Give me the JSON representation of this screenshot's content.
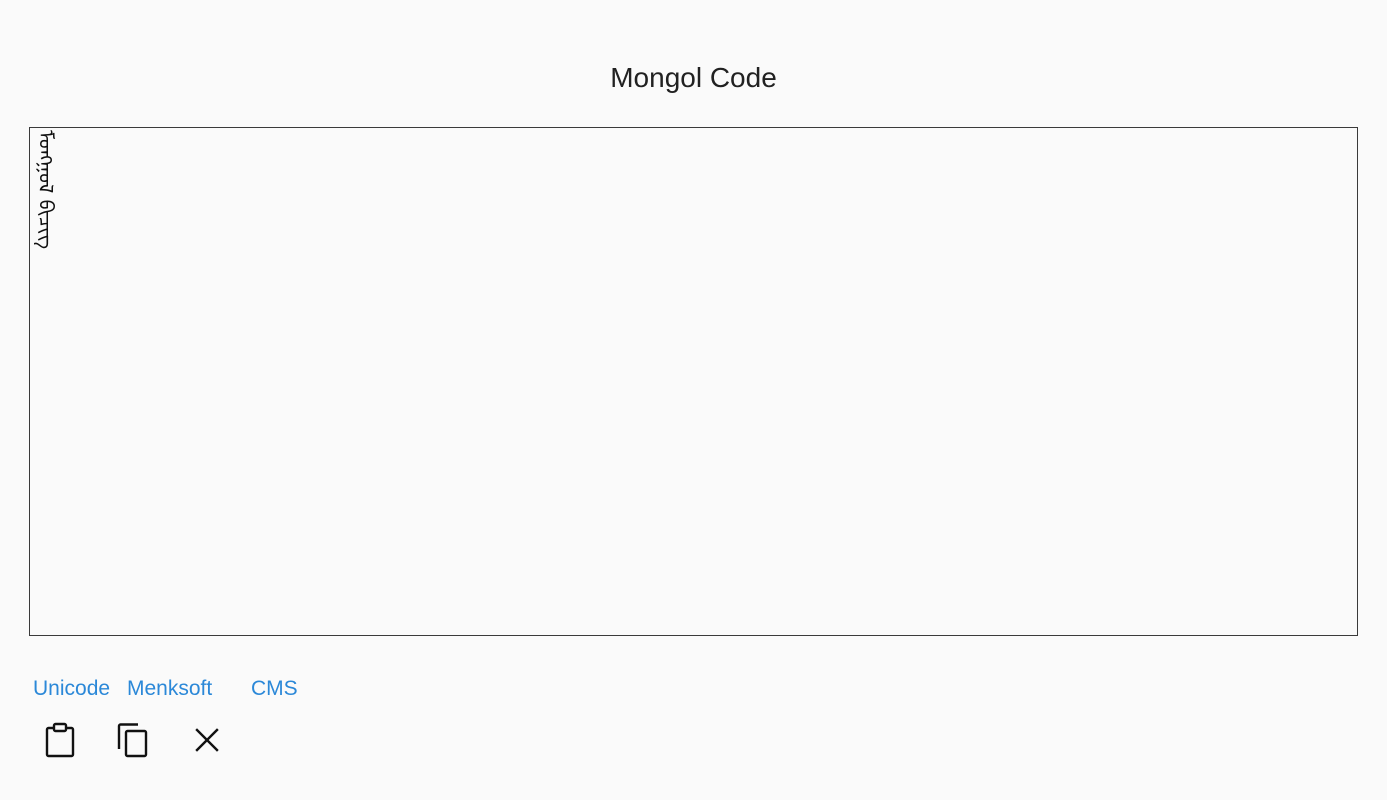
{
  "header": {
    "title": "Mongol Code"
  },
  "editor": {
    "text": "ᠮᠣᠩᠭᠣᠯ ᠪᠢᠴᠢᠭ"
  },
  "convert_buttons": [
    {
      "label": "Unicode"
    },
    {
      "label": "Menksoft"
    },
    {
      "label": "CMS"
    }
  ],
  "toolbar": {
    "paste_icon": "clipboard-icon",
    "copy_icon": "copy-icon",
    "clear_icon": "close-icon"
  },
  "colors": {
    "accent": "#2b88d8",
    "background": "#fafafa",
    "border": "#3a3a3a",
    "text": "#212121"
  }
}
